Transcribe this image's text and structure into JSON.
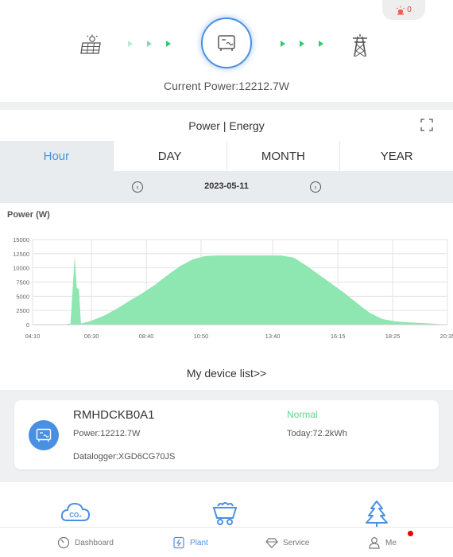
{
  "alarm": {
    "count": "0",
    "icon": "alarm-light-icon"
  },
  "flow": {
    "current_power": "Current Power:12212.7W",
    "source_icon": "solar-panel-icon",
    "center_icon": "inverter-icon",
    "target_icon": "power-pylon-icon",
    "accent_color": "#4a90e2",
    "arrow_color": "#2ecc71"
  },
  "chart_card": {
    "title": "Power | Energy",
    "expand_icon": "expand-icon",
    "tabs": [
      "Hour",
      "DAY",
      "MONTH",
      "YEAR"
    ],
    "active_tab": "Hour",
    "date": "2023-05-11",
    "power_label": "Power (W)"
  },
  "chart_data": {
    "type": "area",
    "ylabel": "Power (W)",
    "ylim": [
      0,
      15000
    ],
    "yticks": [
      "15000",
      "12500",
      "10000",
      "7500",
      "5000",
      "2500",
      "0"
    ],
    "xtick_labels": [
      "04:10",
      "06:30",
      "08:40",
      "10:50",
      "13:40",
      "16:15",
      "18:25",
      "20:35"
    ],
    "x": [
      "04:10",
      "05:20",
      "05:40",
      "05:50",
      "05:55",
      "06:00",
      "06:05",
      "06:10",
      "06:30",
      "07:00",
      "07:30",
      "08:00",
      "08:30",
      "09:00",
      "09:30",
      "10:00",
      "10:30",
      "11:00",
      "11:30",
      "12:00",
      "12:30",
      "13:00",
      "13:30",
      "14:00",
      "14:30",
      "15:00",
      "15:30",
      "16:00",
      "16:30",
      "17:00",
      "17:30",
      "18:00",
      "18:30",
      "19:00",
      "19:30",
      "20:00",
      "20:35"
    ],
    "values": [
      0,
      0,
      200,
      12000,
      6500,
      6200,
      200,
      300,
      700,
      1600,
      2800,
      4200,
      5500,
      7000,
      8700,
      10300,
      11500,
      12100,
      12200,
      12200,
      12200,
      12200,
      12200,
      12200,
      11800,
      10400,
      8800,
      7200,
      5600,
      3800,
      2100,
      1000,
      600,
      420,
      300,
      180,
      0
    ],
    "fill_color": "#8ee6b0",
    "grid": true
  },
  "device_list": {
    "link_label": "My device list>>"
  },
  "device": {
    "name": "RMHDCKB0A1",
    "status": "Normal",
    "power": "Power:12212.7W",
    "today": "Today:72.2kWh",
    "datalogger": "Datalogger:XGD6CG70JS",
    "icon": "inverter-icon",
    "status_color": "#5cd68a"
  },
  "eco": {
    "icons": [
      "co2-cloud-icon",
      "coal-cart-icon",
      "tree-icon"
    ]
  },
  "nav": {
    "items": [
      {
        "label": "Dashboard",
        "icon": "dashboard-icon"
      },
      {
        "label": "Plant",
        "icon": "plant-icon"
      },
      {
        "label": "Service",
        "icon": "service-icon"
      },
      {
        "label": "Me",
        "icon": "user-icon"
      }
    ],
    "active": "Plant"
  }
}
